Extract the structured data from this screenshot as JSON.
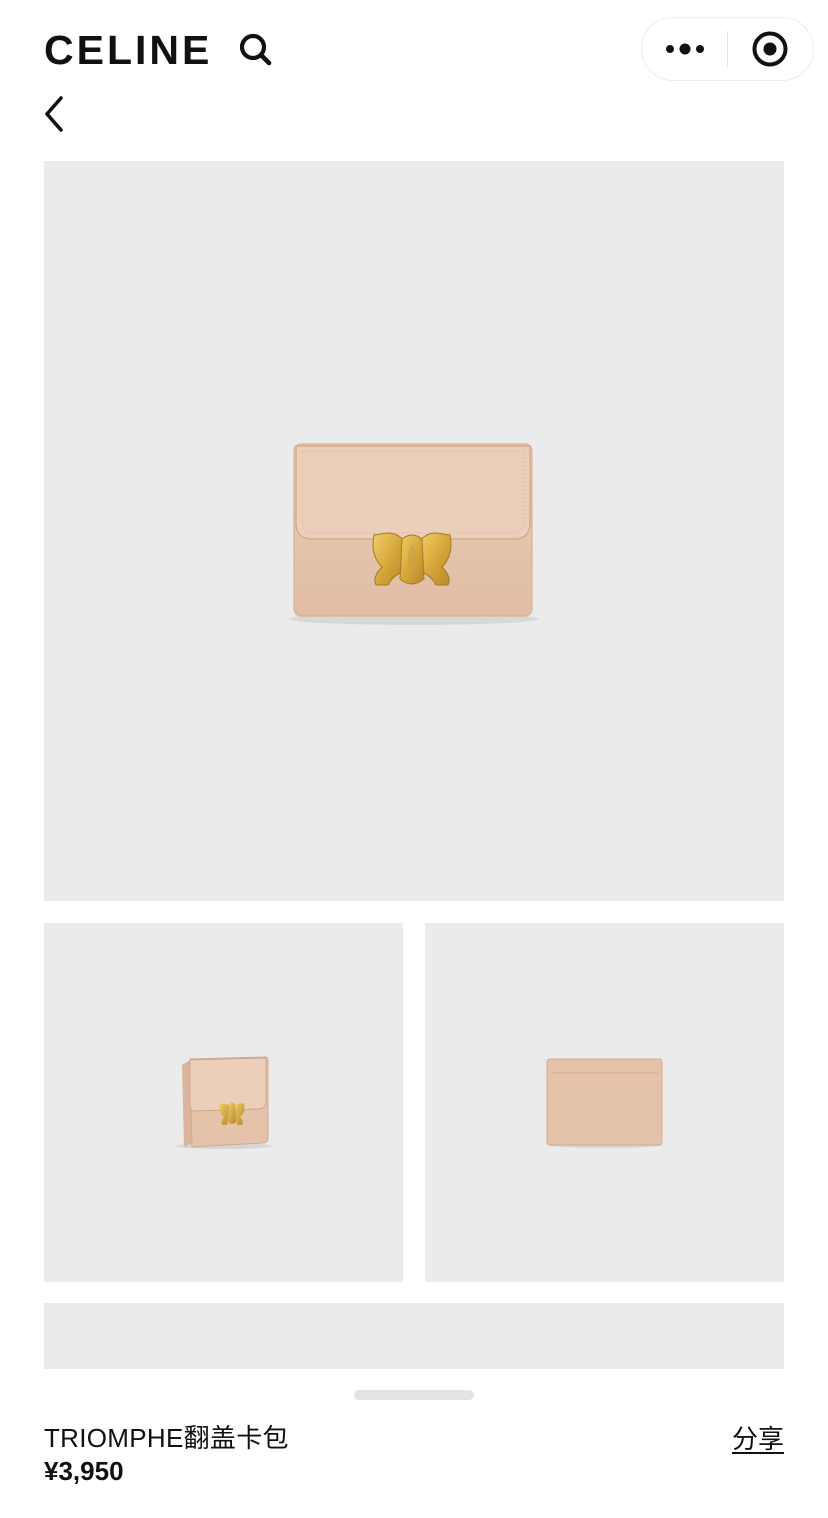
{
  "header": {
    "brand": "CELINE",
    "search_icon": "search-icon",
    "more_icon": "more-dots-icon",
    "close_icon": "target-circle-icon",
    "back_icon": "chevron-left-icon"
  },
  "gallery": {
    "images": [
      {
        "name": "card-holder-front-view",
        "color": "#E5C3AA"
      },
      {
        "name": "card-holder-side-view",
        "color": "#E5C3AA"
      },
      {
        "name": "card-holder-back-view",
        "color": "#E5C3AA"
      },
      {
        "name": "card-holder-detail-view",
        "color": "#E5C3AA"
      }
    ],
    "background": "#EBEBEB",
    "clasp_color": "#D4A53A"
  },
  "product": {
    "name": "TRIOMPHE翻盖卡包",
    "price": "¥3,950",
    "share_label": "分享"
  }
}
